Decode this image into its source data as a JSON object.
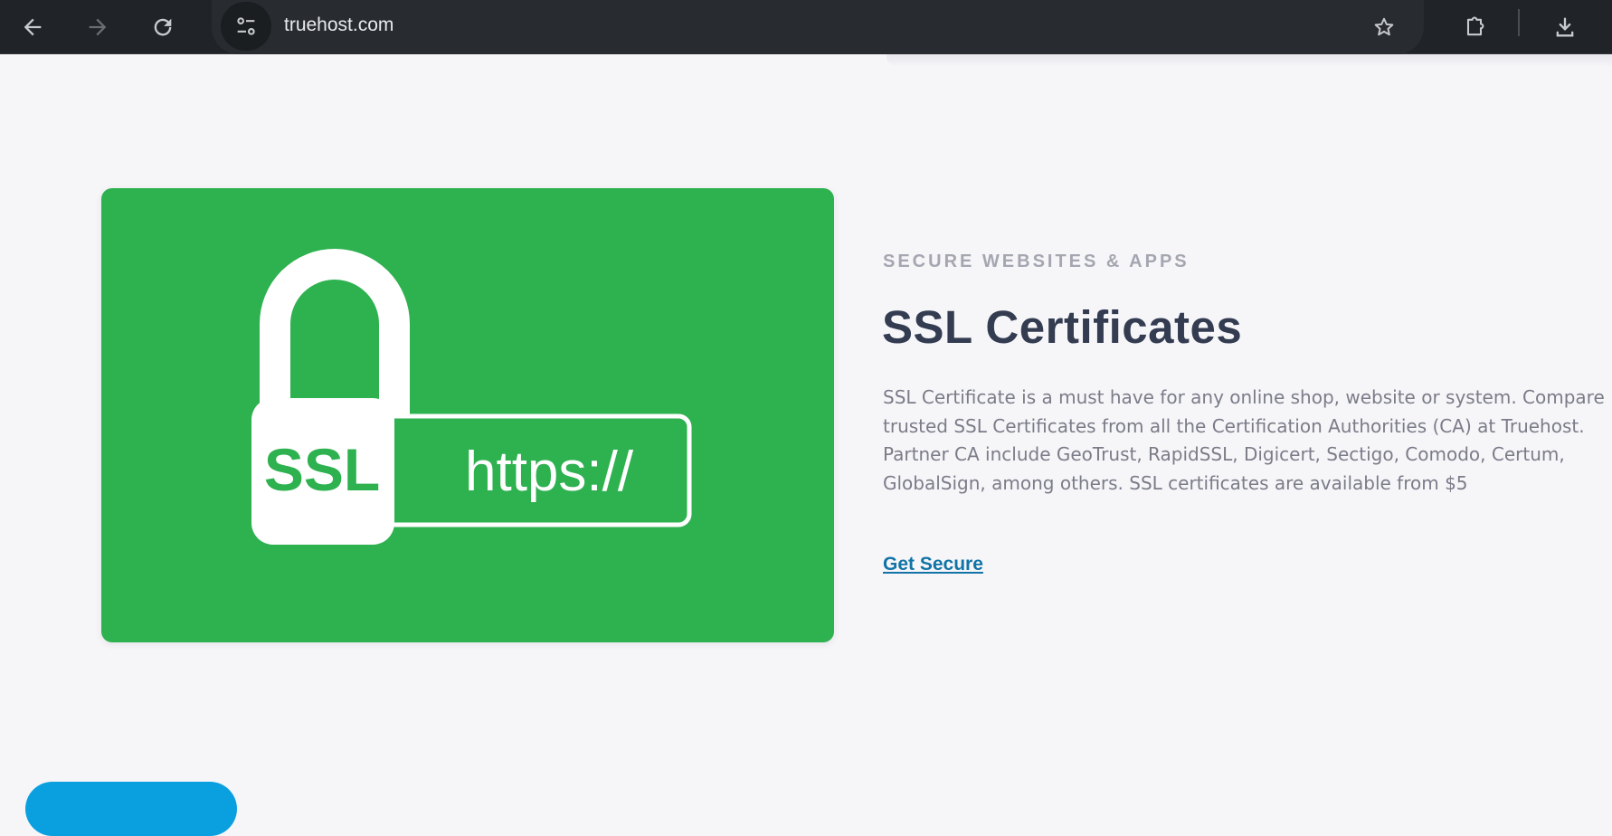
{
  "browser": {
    "url": "truehost.com",
    "icons": {
      "back": "arrow-left-icon",
      "forward": "arrow-right-icon",
      "reload": "reload-icon",
      "site_info": "tune-icon",
      "bookmark": "star-icon",
      "extensions": "puzzle-icon",
      "download": "download-icon"
    }
  },
  "feature": {
    "eyebrow": "SECURE WEBSITES & APPS",
    "title": "SSL Certificates",
    "description": "SSL Certificate is a must have for any online shop, website or system. Compare trusted SSL Certificates from all the Certification Authorities (CA) at Truehost. Partner CA include GeoTrust, RapidSSL, Digicert, Sectigo, Comodo, Certum, GlobalSign, among others. SSL certificates are available from $5",
    "cta": "Get Secure",
    "image": {
      "badge_text": "SSL",
      "url_text": "https://",
      "background": "#2eb14f",
      "icon": "padlock-icon"
    }
  },
  "colors": {
    "accent_link": "#1273a6",
    "heading": "#343c51",
    "muted": "#a4a6b0",
    "body": "#7a7c88",
    "bottom_button": "#0aa0e0"
  }
}
